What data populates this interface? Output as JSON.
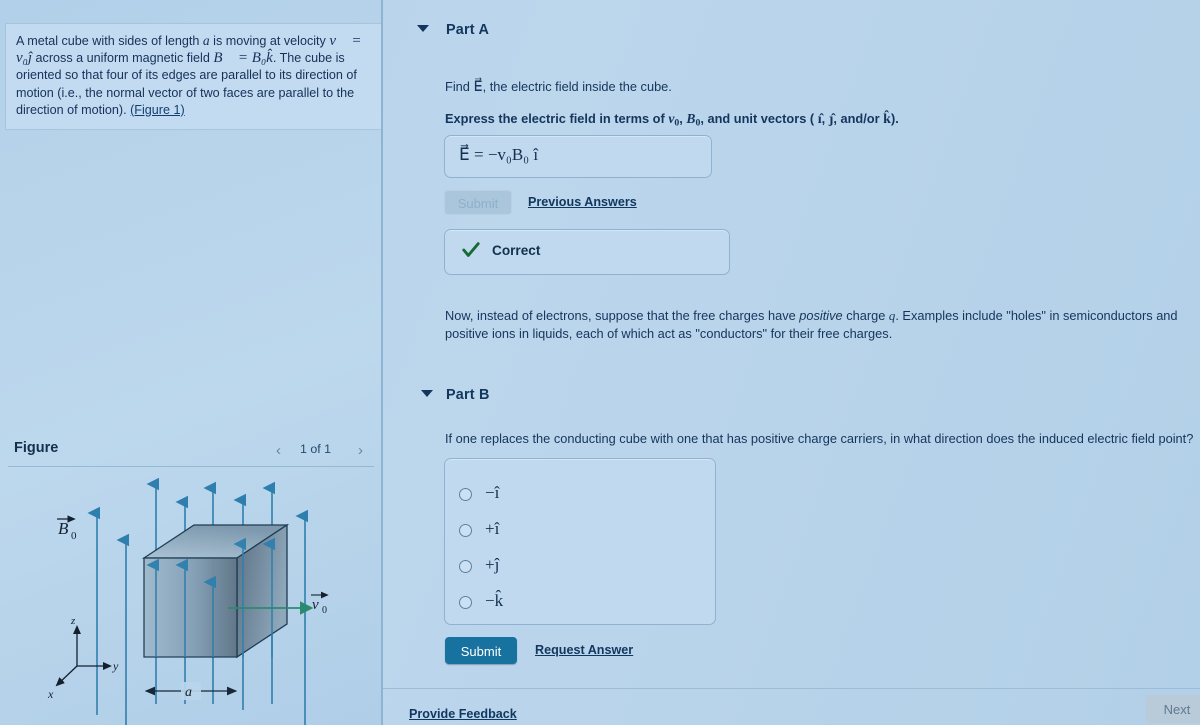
{
  "problem": {
    "text_line1": "A metal cube with sides of length",
    "var_a": "a",
    "text_line1b": "is moving at velocity",
    "eq_v": "v⃗ = v₀ĵ",
    "text_line2": "across a uniform magnetic field",
    "eq_B": "B⃗ = B₀k̂",
    "text_line3": ". The cube is oriented so that four of its edges are parallel to its direction of motion (i.e., the normal vector of two faces are parallel to the direction of motion).",
    "figure_link": "(Figure 1)"
  },
  "figure": {
    "title": "Figure",
    "prev_icon": "chevron-left-icon",
    "next_icon": "chevron-right-icon",
    "counter": "1 of 1",
    "label_B": "B₀",
    "label_v": "v₀",
    "label_a": "a",
    "axis_x": "x",
    "axis_y": "y",
    "axis_z": "z",
    "field_line_color": "#2e7fae",
    "velocity_color": "#2c8a6e",
    "cube_edge_color": "#1d3c52"
  },
  "part_a": {
    "caret_icon": "caret-down-icon",
    "title": "Part A",
    "prompt": "Find E⃗, the electric field inside the cube.",
    "prompt_plain_1": "Find",
    "prompt_plain_2": ", the electric field inside the cube.",
    "instruction": "Express the electric field in terms of v0, B0, and unit vectors ( î, ĵ, and/or k̂).",
    "instruction_part1": "Express the electric field in terms of",
    "instruction_part2": ", and unit vectors (",
    "instruction_part3": ", and/or",
    "instruction_part4": ").",
    "answer_value": "E⃗ =  −v₀B₀ î",
    "submit_label": "Submit",
    "submit_enabled": false,
    "previous_answers_label": "Previous Answers",
    "feedback_icon": "check-icon",
    "feedback_label": "Correct",
    "feedback_color": "#156b35"
  },
  "transition_paragraph": {
    "part1": "Now, instead of electrons, suppose that the free charges have ",
    "emphasis": "positive",
    "part2": " charge ",
    "var_q": "q",
    "part3": ". Examples include \"holes\" in semiconductors and positive ions in liquids, each of which act as \"conductors\" for their free charges."
  },
  "part_b": {
    "caret_icon": "caret-down-icon",
    "title": "Part B",
    "question": "If one replaces the conducting cube with one that has positive charge carriers, in what direction does the induced electric field point?",
    "choices": [
      {
        "label": "−î",
        "selected": false
      },
      {
        "label": "+î",
        "selected": false
      },
      {
        "label": "+ĵ",
        "selected": false
      },
      {
        "label": "−k̂",
        "selected": false
      }
    ],
    "submit_label": "Submit",
    "request_answer_label": "Request Answer"
  },
  "footer": {
    "provide_feedback_label": "Provide Feedback",
    "next_label": "Next"
  },
  "colors": {
    "page_background": "#b7d3ea",
    "panel_background": "#bdd8ed",
    "primary_button": "#17729f",
    "text": "#15355c",
    "link": "#11375f"
  }
}
